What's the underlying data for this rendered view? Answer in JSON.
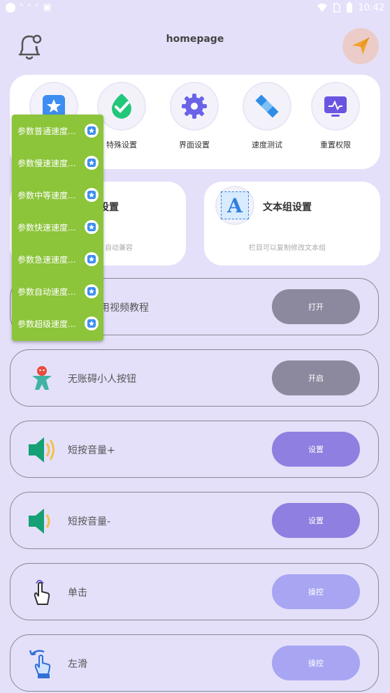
{
  "status_bar": {
    "time": "10:42",
    "notif_glyphs": [
      "ᐡ",
      "ᐡ",
      "ᐡ",
      "▣"
    ]
  },
  "header": {
    "title": "homepage"
  },
  "grid": [
    {
      "label": "特殊设置"
    },
    {
      "label": "界面设置"
    },
    {
      "label": "速度测试"
    },
    {
      "label": "重置权限"
    }
  ],
  "cards": {
    "left": {
      "title": "设置",
      "subtitle": "自动兼容"
    },
    "right": {
      "title": "文本组设置",
      "subtitle": "栏目可以复制修改文本组",
      "icon_letter": "A"
    }
  },
  "rows": [
    {
      "label": "用视频教程",
      "button": "打开"
    },
    {
      "label": "无账碍小人按钮",
      "button": "开启"
    },
    {
      "label": "短按音量+",
      "button": "设置"
    },
    {
      "label": "短按音量-",
      "button": "设置"
    },
    {
      "label": "单击",
      "button": "操控"
    },
    {
      "label": "左滑",
      "button": "操控"
    }
  ],
  "menu": [
    "参数普通速度...",
    "参数慢速速度...",
    "参数中等速度...",
    "参数快速速度...",
    "参数急速速度...",
    "参数自动速度...",
    "参数超级速度..."
  ]
}
